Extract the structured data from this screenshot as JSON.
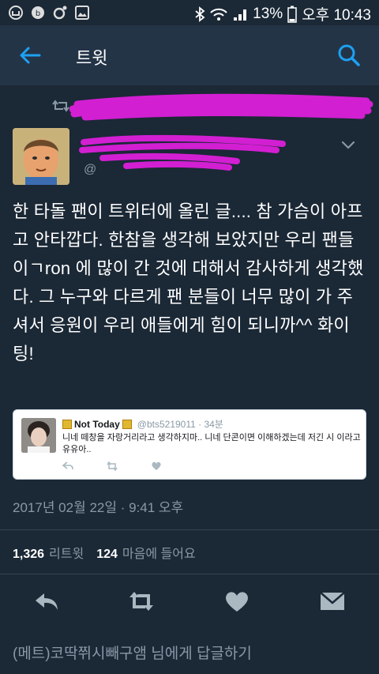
{
  "status_bar": {
    "battery_pct": "13%",
    "time": "오후 10:43"
  },
  "app_bar": {
    "title": "트윗"
  },
  "retweet_header": {
    "text": ". * .*° +"
  },
  "author": {
    "handle": "@"
  },
  "tweet": {
    "text": "한 타돌 팬이 트위터에 올린 글.... 참 가슴이 아프고 안타깝다. 한참을 생각해 보았지만 우리 팬들이ㄱron 에 많이 간 것에 대해서 감사하게 생각했다. 그 누구와 다르게 팬 분들이 너무 많이 가 주셔서 응원이 우리 애들에게 힘이 되니까^^ 화이팅!"
  },
  "embedded_tweet": {
    "name": "Not Today",
    "handle": "@bts5219011 · 34분",
    "text": "니네 떼창을 자랑거리라고 생각하지마.. 니네 단콘이면 이해하겠는데 저긴 시 이라고 유유아.."
  },
  "timestamp": "2017년 02월 22일 · 9:41 오후",
  "stats": {
    "retweets": "1,326",
    "retweets_label": "리트윗",
    "likes": "124",
    "likes_label": "마음에 들어요"
  },
  "reply_box": {
    "placeholder": "(메트)코딱쮜시빼구앰 님에게 답글하기"
  },
  "colors": {
    "background": "#1b2836",
    "app_bar": "#243447",
    "accent": "#1da1f2",
    "muted": "#8899a6",
    "scribble": "#d21fd2"
  }
}
